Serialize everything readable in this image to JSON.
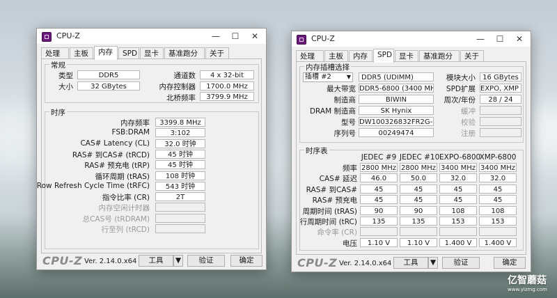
{
  "win1": {
    "title": "CPU-Z",
    "tabs": [
      "处理器",
      "主板",
      "内存",
      "SPD",
      "显卡",
      "基准跑分",
      "关于"
    ],
    "general": {
      "label": "常规",
      "type_label": "类型",
      "type_value": "DDR5",
      "size_label": "大小",
      "size_value": "32 GBytes",
      "channels_label": "通道数",
      "channels_value": "4 x 32-bit",
      "mc_label": "内存控制器",
      "mc_value": "1700.0 MHz",
      "nb_label": "北桥频率",
      "nb_value": "3799.9 MHz"
    },
    "timings": {
      "label": "时序",
      "rows": [
        {
          "label": "内存频率",
          "value": "3399.8 MHz",
          "enabled": true
        },
        {
          "label": "FSB:DRAM",
          "value": "3:102",
          "enabled": true
        },
        {
          "label": "CAS# Latency (CL)",
          "value": "32.0 时钟",
          "enabled": true
        },
        {
          "label": "RAS# 到CAS# (tRCD)",
          "value": "45 时钟",
          "enabled": true
        },
        {
          "label": "RAS# 预充电 (tRP)",
          "value": "45 时钟",
          "enabled": true
        },
        {
          "label": "循环周期 (tRAS)",
          "value": "108 时钟",
          "enabled": true
        },
        {
          "label": "Row Refresh Cycle Time (tRFC)",
          "value": "543 时钟",
          "enabled": true
        },
        {
          "label": "指令比率 (CR)",
          "value": "2T",
          "enabled": true
        },
        {
          "label": "内存空闲计时器",
          "value": "",
          "enabled": false
        },
        {
          "label": "总CAS号 (tRDRAM)",
          "value": "",
          "enabled": false
        },
        {
          "label": "行至列 (tRCD)",
          "value": "",
          "enabled": false
        }
      ]
    },
    "bottom": {
      "brand": "CPU-Z",
      "version": "Ver. 2.14.0.x64",
      "tools": "工具",
      "validate": "验证",
      "ok": "确定"
    }
  },
  "win2": {
    "title": "CPU-Z",
    "tabs": [
      "处理器",
      "主板",
      "内存",
      "SPD",
      "显卡",
      "基准跑分",
      "关于"
    ],
    "slot": {
      "label": "内存插槽选择",
      "slot_label": "插槽 #2",
      "type_value": "DDR5 (UDIMM)",
      "maxbw_label": "最大带宽",
      "maxbw_value": "DDR5-6800 (3400 MHz)",
      "maker_label": "制造商",
      "maker_value": "BIWIN",
      "dram_label": "DRAM 制造商",
      "dram_value": "SK Hynix",
      "part_label": "型号",
      "part_value": "DW100326832FR2G-CW0",
      "serial_label": "序列号",
      "serial_value": "00249474",
      "modsize_label": "模块大小",
      "modsize_value": "16 GBytes",
      "spdext_label": "SPD扩展",
      "spdext_value": "EXPO, XMP 3.0",
      "week_label": "周次/年份",
      "week_value": "28 / 24",
      "buffer_label": "缓冲",
      "check_label": "校验",
      "reg_label": "注册"
    },
    "timings": {
      "label": "时序表",
      "headers": [
        "JEDEC #9",
        "JEDEC #10",
        "EXPO-6800",
        "XMP-6800"
      ],
      "rows": [
        {
          "label": "频率",
          "values": [
            "2800 MHz",
            "2800 MHz",
            "3400 MHz",
            "3400 MHz"
          ],
          "enabled": true
        },
        {
          "label": "CAS# 延迟",
          "values": [
            "46.0",
            "50.0",
            "32.0",
            "32.0"
          ],
          "enabled": true
        },
        {
          "label": "RAS# 到CAS#",
          "values": [
            "45",
            "45",
            "45",
            "45"
          ],
          "enabled": true
        },
        {
          "label": "RAS# 预充电",
          "values": [
            "45",
            "45",
            "45",
            "45"
          ],
          "enabled": true
        },
        {
          "label": "周期时间 (tRAS)",
          "values": [
            "90",
            "90",
            "108",
            "108"
          ],
          "enabled": true
        },
        {
          "label": "行周期时间 (tRC)",
          "values": [
            "135",
            "135",
            "153",
            "153"
          ],
          "enabled": true
        },
        {
          "label": "命令率 (CR)",
          "values": [
            "",
            "",
            "",
            ""
          ],
          "enabled": false
        },
        {
          "label": "电压",
          "values": [
            "1.10 V",
            "1.10 V",
            "1.400 V",
            "1.400 V"
          ],
          "enabled": true
        }
      ]
    },
    "bottom": {
      "brand": "CPU-Z",
      "version": "Ver. 2.14.0.x64",
      "tools": "工具",
      "validate": "验证",
      "ok": "确定"
    }
  },
  "watermark": {
    "name": "亿智蘑菇",
    "url": "www.yizmg.com"
  }
}
